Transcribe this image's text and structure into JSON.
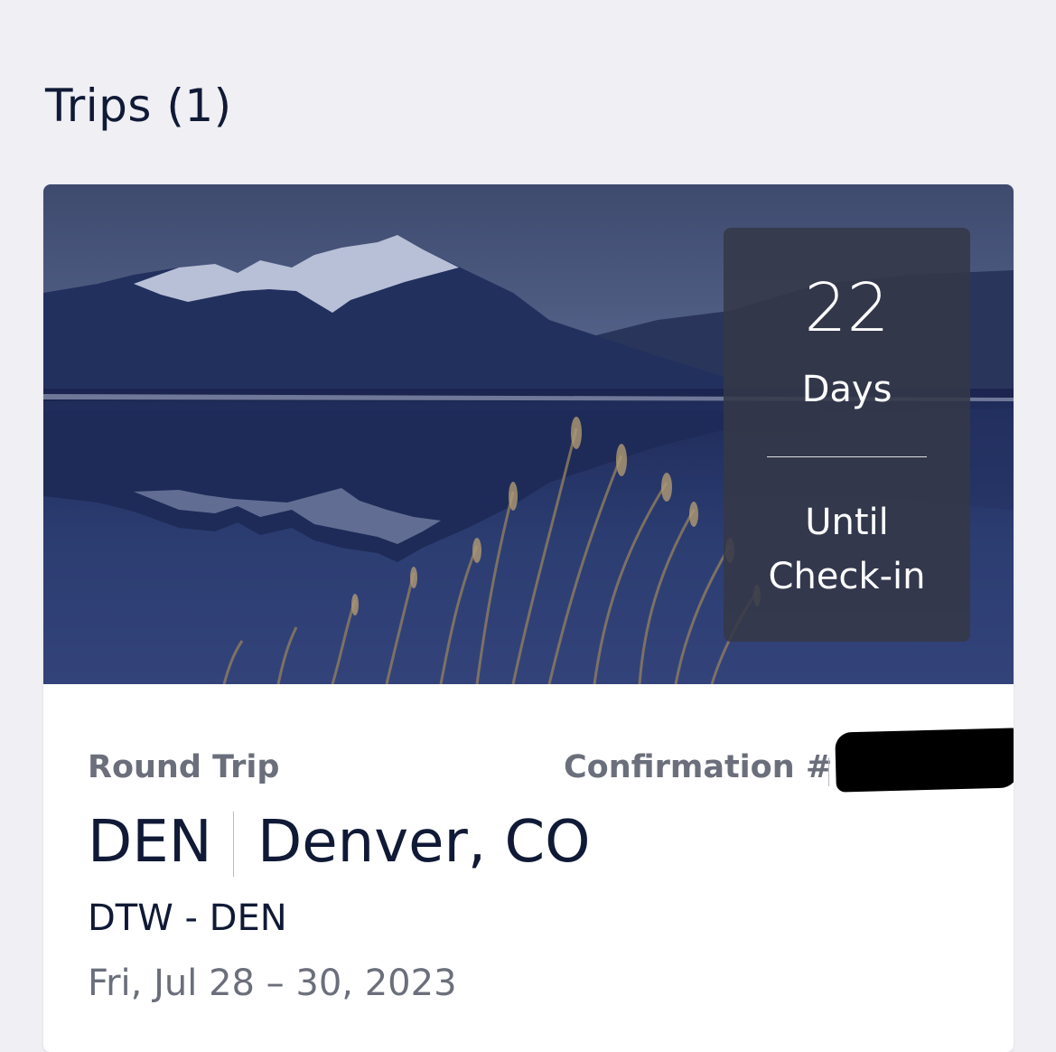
{
  "page": {
    "title": "Trips (1)"
  },
  "trip": {
    "countdown": {
      "number": "22",
      "unit": "Days",
      "caption_line1": "Until",
      "caption_line2": "Check-in"
    },
    "trip_type": "Round Trip",
    "confirmation_label": "Confirmation #",
    "confirmation_value": "",
    "destination_code": "DEN",
    "destination_city": "Denver, CO",
    "route": "DTW - DEN",
    "dates": "Fri, Jul 28 – 30, 2023"
  },
  "colors": {
    "background": "#efeff4",
    "text_primary": "#101a36",
    "text_secondary": "#6b6f7b",
    "countdown_panel": "#343848"
  },
  "icons": {
    "hero_image": "mountain-lake-image"
  }
}
